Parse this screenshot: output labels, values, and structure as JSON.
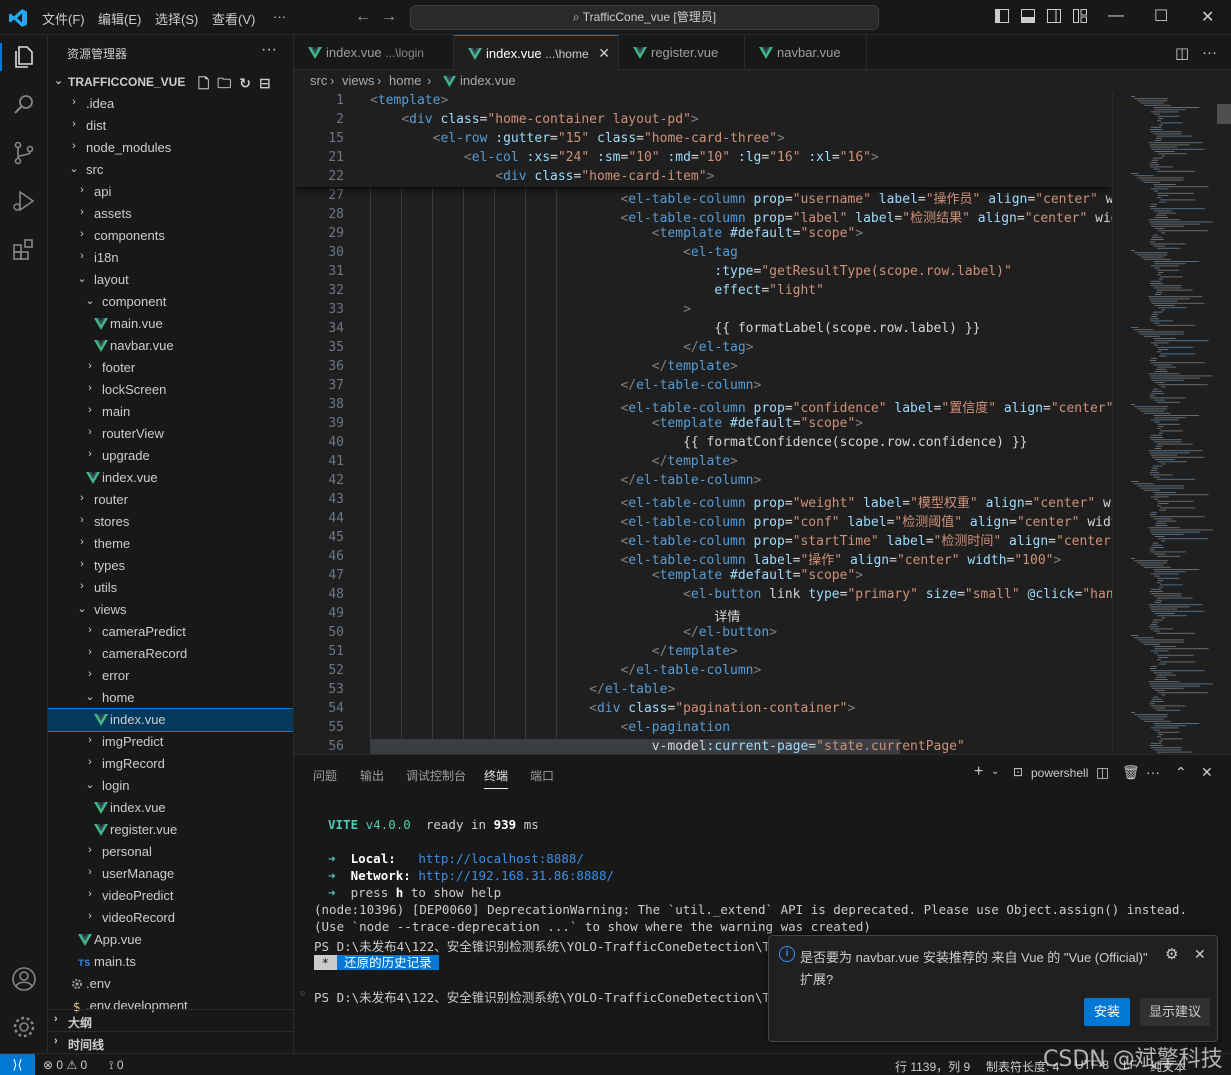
{
  "titlebar": {
    "menus": [
      "文件(F)",
      "编辑(E)",
      "选择(S)",
      "查看(V)",
      "···"
    ],
    "search": "TrafficCone_vue [管理员]"
  },
  "sidebar": {
    "title": "资源管理器",
    "project": "TRAFFICCONE_VUE",
    "tree": [
      {
        "label": ".idea",
        "depth": 0,
        "type": "folder",
        "open": false
      },
      {
        "label": "dist",
        "depth": 0,
        "type": "folder",
        "open": false
      },
      {
        "label": "node_modules",
        "depth": 0,
        "type": "folder",
        "open": false
      },
      {
        "label": "src",
        "depth": 0,
        "type": "folder",
        "open": true
      },
      {
        "label": "api",
        "depth": 1,
        "type": "folder",
        "open": false
      },
      {
        "label": "assets",
        "depth": 1,
        "type": "folder",
        "open": false
      },
      {
        "label": "components",
        "depth": 1,
        "type": "folder",
        "open": false
      },
      {
        "label": "i18n",
        "depth": 1,
        "type": "folder",
        "open": false
      },
      {
        "label": "layout",
        "depth": 1,
        "type": "folder",
        "open": true
      },
      {
        "label": "component",
        "depth": 2,
        "type": "folder",
        "open": true
      },
      {
        "label": "main.vue",
        "depth": 3,
        "type": "vue"
      },
      {
        "label": "navbar.vue",
        "depth": 3,
        "type": "vue"
      },
      {
        "label": "footer",
        "depth": 2,
        "type": "folder",
        "open": false
      },
      {
        "label": "lockScreen",
        "depth": 2,
        "type": "folder",
        "open": false
      },
      {
        "label": "main",
        "depth": 2,
        "type": "folder",
        "open": false
      },
      {
        "label": "routerView",
        "depth": 2,
        "type": "folder",
        "open": false
      },
      {
        "label": "upgrade",
        "depth": 2,
        "type": "folder",
        "open": false
      },
      {
        "label": "index.vue",
        "depth": 2,
        "type": "vue"
      },
      {
        "label": "router",
        "depth": 1,
        "type": "folder",
        "open": false
      },
      {
        "label": "stores",
        "depth": 1,
        "type": "folder",
        "open": false
      },
      {
        "label": "theme",
        "depth": 1,
        "type": "folder",
        "open": false
      },
      {
        "label": "types",
        "depth": 1,
        "type": "folder",
        "open": false
      },
      {
        "label": "utils",
        "depth": 1,
        "type": "folder",
        "open": false
      },
      {
        "label": "views",
        "depth": 1,
        "type": "folder",
        "open": true
      },
      {
        "label": "cameraPredict",
        "depth": 2,
        "type": "folder",
        "open": false
      },
      {
        "label": "cameraRecord",
        "depth": 2,
        "type": "folder",
        "open": false
      },
      {
        "label": "error",
        "depth": 2,
        "type": "folder",
        "open": false
      },
      {
        "label": "home",
        "depth": 2,
        "type": "folder",
        "open": true
      },
      {
        "label": "index.vue",
        "depth": 3,
        "type": "vue",
        "selected": true
      },
      {
        "label": "imgPredict",
        "depth": 2,
        "type": "folder",
        "open": false
      },
      {
        "label": "imgRecord",
        "depth": 2,
        "type": "folder",
        "open": false
      },
      {
        "label": "login",
        "depth": 2,
        "type": "folder",
        "open": true
      },
      {
        "label": "index.vue",
        "depth": 3,
        "type": "vue"
      },
      {
        "label": "register.vue",
        "depth": 3,
        "type": "vue"
      },
      {
        "label": "personal",
        "depth": 2,
        "type": "folder",
        "open": false
      },
      {
        "label": "userManage",
        "depth": 2,
        "type": "folder",
        "open": false
      },
      {
        "label": "videoPredict",
        "depth": 2,
        "type": "folder",
        "open": false
      },
      {
        "label": "videoRecord",
        "depth": 2,
        "type": "folder",
        "open": false
      },
      {
        "label": "App.vue",
        "depth": 1,
        "type": "vue"
      },
      {
        "label": "main.ts",
        "depth": 1,
        "type": "ts"
      },
      {
        "label": ".env",
        "depth": 0,
        "type": "gear"
      },
      {
        "label": ".env.development",
        "depth": 0,
        "type": "dollar"
      }
    ],
    "outline": "大纲",
    "timeline": "时间线"
  },
  "tabs": [
    {
      "name": "index.vue",
      "sub": "...\\login",
      "active": false
    },
    {
      "name": "index.vue",
      "sub": "...\\home",
      "active": true
    },
    {
      "name": "register.vue",
      "sub": "",
      "active": false
    },
    {
      "name": "navbar.vue",
      "sub": "",
      "active": false
    }
  ],
  "breadcrumb": [
    "src",
    "views",
    "home",
    "index.vue"
  ],
  "sticky_lines": [
    {
      "n": "1",
      "code": "<template>"
    },
    {
      "n": "2",
      "code": "    <div class=\"home-container layout-pd\">"
    },
    {
      "n": "15",
      "code": "        <el-row :gutter=\"15\" class=\"home-card-three\">"
    },
    {
      "n": "21",
      "code": "            <el-col :xs=\"24\" :sm=\"10\" :md=\"10\" :lg=\"16\" :xl=\"16\">"
    },
    {
      "n": "22",
      "code": "                <div class=\"home-card-item\">"
    }
  ],
  "code_lines": [
    {
      "n": "27",
      "code": "                                <el-table-column prop=\"username\" label=\"操作员\" align=\"center\" wi"
    },
    {
      "n": "28",
      "code": "                                <el-table-column prop=\"label\" label=\"检测结果\" align=\"center\" wid"
    },
    {
      "n": "29",
      "code": "                                    <template #default=\"scope\">"
    },
    {
      "n": "30",
      "code": "                                        <el-tag"
    },
    {
      "n": "31",
      "code": "                                            :type=\"getResultType(scope.row.label)\""
    },
    {
      "n": "32",
      "code": "                                            effect=\"light\""
    },
    {
      "n": "33",
      "code": "                                        >"
    },
    {
      "n": "34",
      "code": "                                            {{ formatLabel(scope.row.label) }}"
    },
    {
      "n": "35",
      "code": "                                        </el-tag>"
    },
    {
      "n": "36",
      "code": "                                    </template>"
    },
    {
      "n": "37",
      "code": "                                </el-table-column>"
    },
    {
      "n": "38",
      "code": "                                <el-table-column prop=\"confidence\" label=\"置信度\" align=\"center\""
    },
    {
      "n": "39",
      "code": "                                    <template #default=\"scope\">"
    },
    {
      "n": "40",
      "code": "                                        {{ formatConfidence(scope.row.confidence) }}"
    },
    {
      "n": "41",
      "code": "                                    </template>"
    },
    {
      "n": "42",
      "code": "                                </el-table-column>"
    },
    {
      "n": "43",
      "code": "                                <el-table-column prop=\"weight\" label=\"模型权重\" align=\"center\" wi"
    },
    {
      "n": "44",
      "code": "                                <el-table-column prop=\"conf\" label=\"检测阈值\" align=\"center\" widt"
    },
    {
      "n": "45",
      "code": "                                <el-table-column prop=\"startTime\" label=\"检测时间\" align=\"center\""
    },
    {
      "n": "46",
      "code": "                                <el-table-column label=\"操作\" align=\"center\" width=\"100\">"
    },
    {
      "n": "47",
      "code": "                                    <template #default=\"scope\">"
    },
    {
      "n": "48",
      "code": "                                        <el-button link type=\"primary\" size=\"small\" @click=\"hand"
    },
    {
      "n": "49",
      "code": "                                            详情"
    },
    {
      "n": "50",
      "code": "                                        </el-button>"
    },
    {
      "n": "51",
      "code": "                                    </template>"
    },
    {
      "n": "52",
      "code": "                                </el-table-column>"
    },
    {
      "n": "53",
      "code": "                            </el-table>"
    },
    {
      "n": "54",
      "code": "                            <div class=\"pagination-container\">"
    },
    {
      "n": "55",
      "code": "                                <el-pagination"
    },
    {
      "n": "56",
      "code": "                                    v-model:current-page=\"state.currentPage\""
    }
  ],
  "panel": {
    "tabs": [
      "问题",
      "输出",
      "调试控制台",
      "终端",
      "端口"
    ],
    "active_tab": "终端",
    "shell": "powershell",
    "terminal": {
      "vite_name": "VITE",
      "vite_version": "v4.0.0",
      "ready_text": "ready in",
      "ready_ms": "939",
      "ms": "ms",
      "local_label": "Local:",
      "local_url": "http://localhost:8888/",
      "network_label": "Network:",
      "network_url": "http://192.168.31.86:8888/",
      "help_prefix": "press",
      "help_key": "h",
      "help_suffix": "to show help",
      "warn1": "(node:10396) [DEP0060] DeprecationWarning: The `util._extend` API is deprecated. Please use Object.assign() instead.",
      "warn2": "(Use `node --trace-deprecation ...` to show where the warning was created)",
      "ps1": "PS D:\\未发布4\\122、安全锥识别检测系统\\YOLO-TrafficConeDetection\\T",
      "history": "还原的历史记录",
      "ps2": "PS D:\\未发布4\\122、安全锥识别检测系统\\YOLO-TrafficConeDetection\\T"
    }
  },
  "notification": {
    "text": "是否要为 navbar.vue 安装推荐的 来自 Vue 的 \"Vue (Official)\"",
    "text2": "扩展?",
    "install": "安装",
    "show": "显示建议"
  },
  "statusbar": {
    "errors": "0",
    "warnings": "0",
    "ports": "0",
    "position": "行 1139，列 9",
    "tabsize": "制表符长度: 4",
    "encoding": "UTF-8",
    "eol": "LF",
    "lang": "纯文本"
  },
  "watermark": "CSDN @斌擎科技",
  "colors": {
    "accent": "#0078d4",
    "vue_green": "#41b883"
  }
}
